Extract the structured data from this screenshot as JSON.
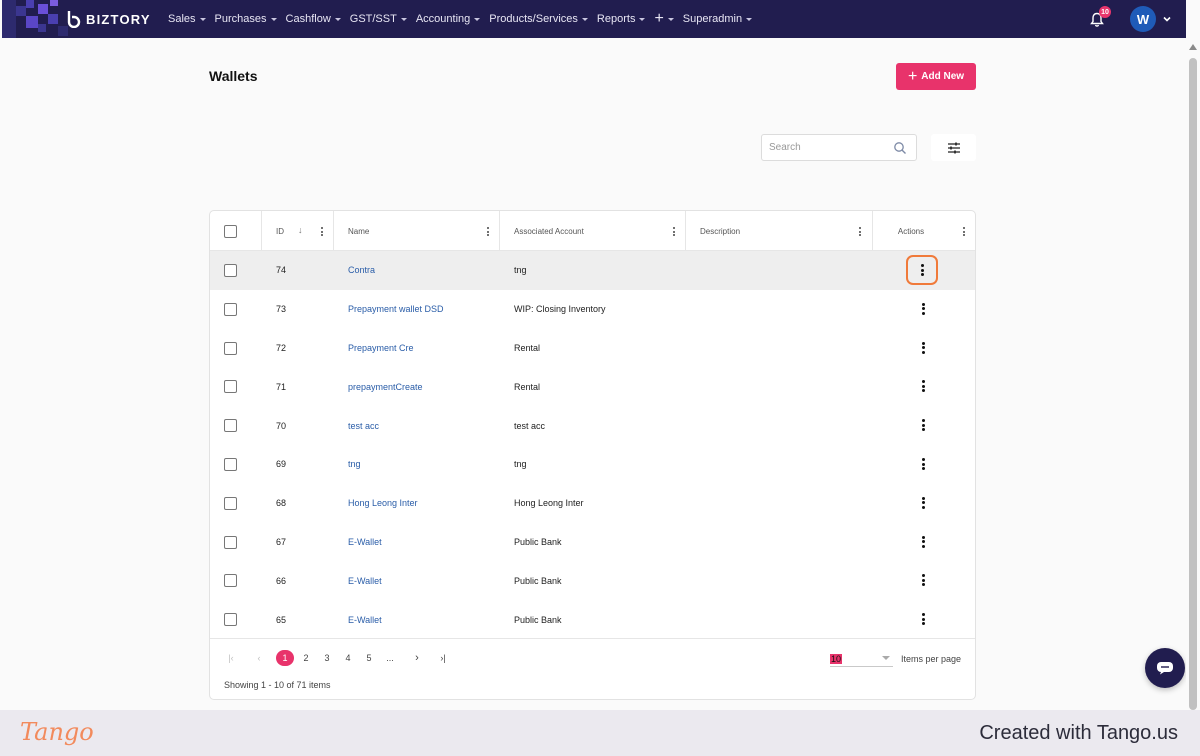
{
  "app": {
    "brand": "BIZTORY",
    "nav": [
      {
        "label": "Sales"
      },
      {
        "label": "Purchases"
      },
      {
        "label": "Cashflow"
      },
      {
        "label": "GST/SST"
      },
      {
        "label": "Accounting"
      },
      {
        "label": "Products/Services"
      },
      {
        "label": "Reports"
      },
      {
        "label": "+"
      },
      {
        "label": "Superadmin"
      }
    ],
    "notification_count": "10",
    "avatar_initial": "W"
  },
  "page": {
    "title": "Wallets",
    "add_button_label": "Add New",
    "search_placeholder": "Search"
  },
  "table": {
    "columns": {
      "id": "ID",
      "name": "Name",
      "associated_account": "Associated Account",
      "description": "Description",
      "actions": "Actions"
    },
    "rows": [
      {
        "id": "74",
        "name": "Contra",
        "account": "tng",
        "description": ""
      },
      {
        "id": "73",
        "name": "Prepayment wallet DSD",
        "account": "WIP: Closing Inventory",
        "description": ""
      },
      {
        "id": "72",
        "name": "Prepayment Cre",
        "account": "Rental",
        "description": ""
      },
      {
        "id": "71",
        "name": "prepaymentCreate",
        "account": "Rental",
        "description": ""
      },
      {
        "id": "70",
        "name": "test acc",
        "account": "test acc",
        "description": ""
      },
      {
        "id": "69",
        "name": "tng",
        "account": "tng",
        "description": ""
      },
      {
        "id": "68",
        "name": "Hong Leong Inter",
        "account": "Hong Leong Inter",
        "description": ""
      },
      {
        "id": "67",
        "name": "E-Wallet",
        "account": "Public Bank",
        "description": ""
      },
      {
        "id": "66",
        "name": "E-Wallet",
        "account": "Public Bank",
        "description": ""
      },
      {
        "id": "65",
        "name": "E-Wallet",
        "account": "Public Bank",
        "description": ""
      }
    ]
  },
  "pagination": {
    "pages": [
      "1",
      "2",
      "3",
      "4",
      "5",
      "..."
    ],
    "current_page": "1",
    "items_per_page": "10",
    "items_per_page_label": "Items per page",
    "summary": "Showing 1 - 10 of 71 items"
  },
  "footer": {
    "tango_logo": "Tango",
    "created_with": "Created with Tango.us"
  },
  "colors": {
    "navbar": "#211d4f",
    "accent": "#e8336b",
    "link": "#2a5da8",
    "highlight_ring": "#f07a3a"
  }
}
